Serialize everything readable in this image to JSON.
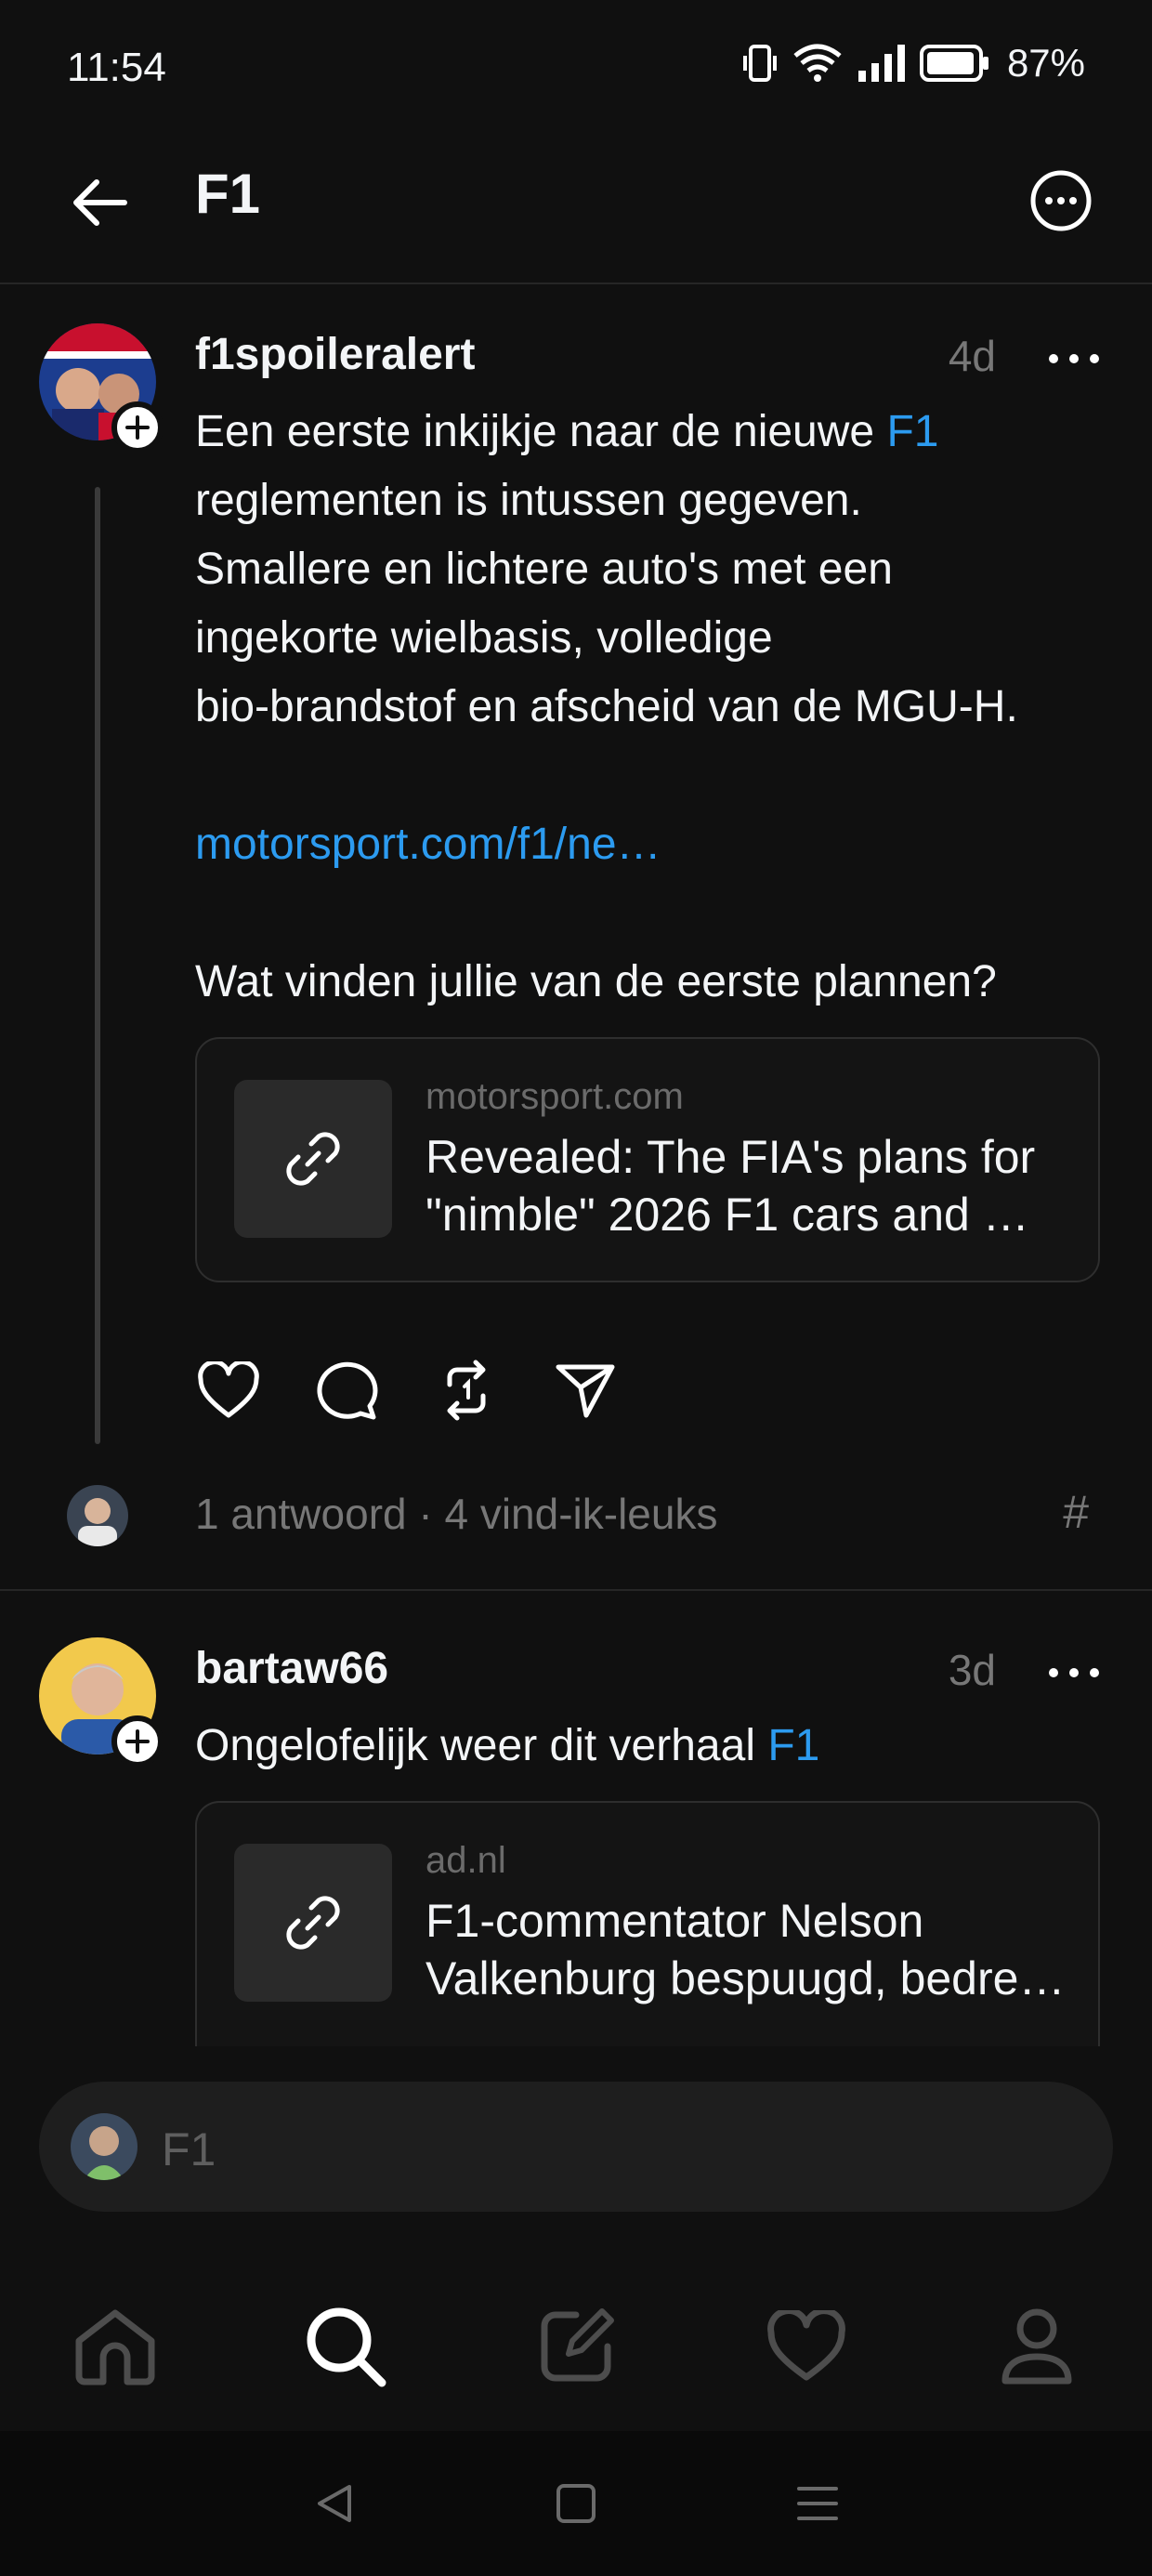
{
  "status_bar": {
    "time": "11:54",
    "battery": "87%"
  },
  "header": {
    "title": "F1",
    "back_icon": "arrow-left-icon",
    "more_icon": "ellipsis-circle-icon"
  },
  "posts": [
    {
      "username": "f1spoileralert",
      "time": "4d",
      "text_lines": [
        {
          "pre": "Een eerste inkijkje naar de nieuwe ",
          "link": "F1"
        },
        {
          "pre": "reglementen is intussen gegeven."
        },
        {
          "pre": "Smallere en lichtere auto's met een"
        },
        {
          "pre": "ingekorte wielbasis, volledige"
        },
        {
          "pre": "bio-brandstof en afscheid van de MGU-H."
        }
      ],
      "url": "motorsport.com/f1/ne…",
      "question": "Wat vinden jullie van de eerste plannen?",
      "card": {
        "domain": "motorsport.com",
        "title_line1": "Revealed: The FIA's plans for",
        "title_line2": "\"nimble\" 2026 F1 cars and …"
      },
      "stats": "1 antwoord · 4 vind-ik-leuks",
      "hash": "#"
    },
    {
      "username": "bartaw66",
      "time": "3d",
      "text_pre": "Ongelofelijk weer dit verhaal ",
      "text_link": "F1",
      "card": {
        "domain": "ad.nl",
        "title_line1": "F1-commentator Nelson",
        "title_line2": "Valkenburg bespuugd, bedre…"
      }
    }
  ],
  "reply": {
    "placeholder": "F1"
  },
  "nav": [
    "home-icon",
    "search-icon",
    "compose-icon",
    "heart-icon",
    "profile-icon"
  ],
  "colors": {
    "background": "#101010",
    "link": "#2c9bf0",
    "muted": "#777777"
  }
}
